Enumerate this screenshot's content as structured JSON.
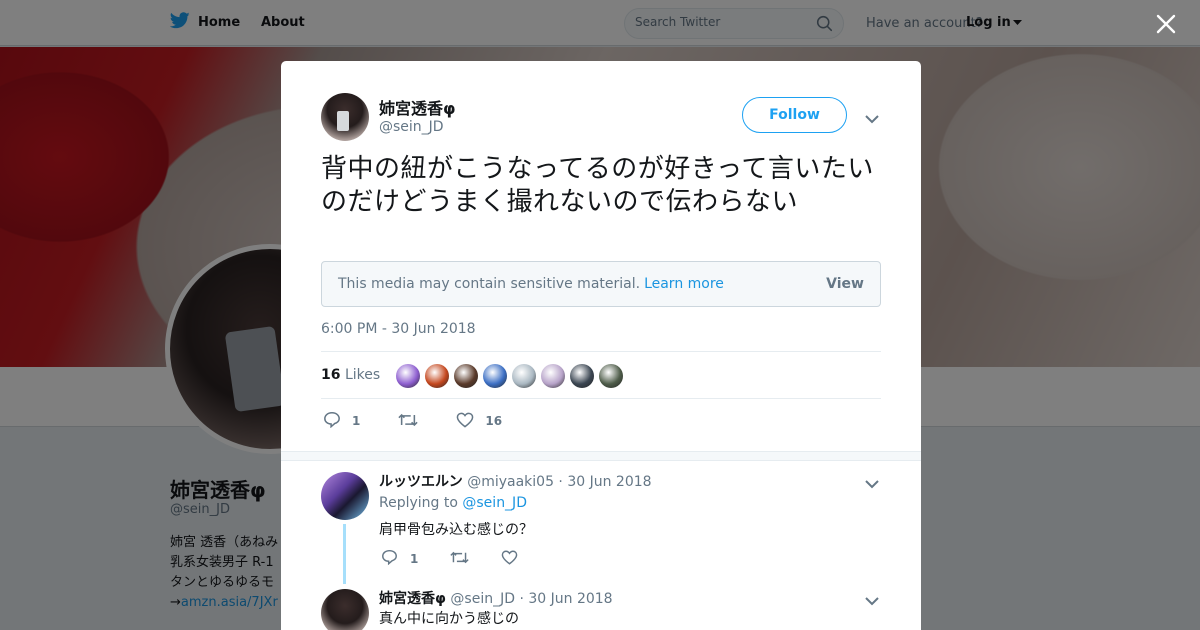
{
  "topbar": {
    "home_label": "Home",
    "about_label": "About",
    "search_placeholder": "Search Twitter",
    "have_account": "Have an account?",
    "login_label": "Log in"
  },
  "profile": {
    "name": "姉宮透香φ",
    "handle": "@sein_JD",
    "bio_lines": [
      "姉宮 透香（あねみ",
      "乳系女装男子 R-1",
      "タンとゆるゆるモ"
    ],
    "bio_link": "amzn.asia/7JXr",
    "bio_link_prefix": "→"
  },
  "tweet": {
    "author_name": "姉宮透香φ",
    "author_handle": "@sein_JD",
    "follow_label": "Follow",
    "text": "背中の紐がこうなってるのが好きって言いたいのだけどうまく撮れないので伝わらない",
    "sensitive_msg": "This media may contain sensitive material.",
    "learn_more": "Learn more",
    "view_label": "View",
    "timestamp": "6:00 PM - 30 Jun 2018",
    "likes_count": "16",
    "likes_label": "Likes",
    "reply_count": "1",
    "like_count_action": "16",
    "liker_colors": [
      "#8e5fd0",
      "#c4471e",
      "#5a3a2a",
      "#3c6fc4",
      "#aab8c2",
      "#b7a3c9",
      "#3b4652",
      "#4f5d4a"
    ]
  },
  "replies": [
    {
      "name": "ルッツエルン",
      "handle": "@miyaaki05",
      "date": "30 Jun 2018",
      "replying_prefix": "Replying to",
      "replying_to": "@sein_JD",
      "text": "肩甲骨包み込む感じの？",
      "reply_count": "1"
    },
    {
      "name": "姉宮透香φ",
      "handle": "@sein_JD",
      "date": "30 Jun 2018",
      "text": "真ん中に向かう感じの"
    }
  ],
  "colors": {
    "twitter_blue": "#1da1f2",
    "link_blue": "#1b95e0",
    "muted": "#657786"
  }
}
